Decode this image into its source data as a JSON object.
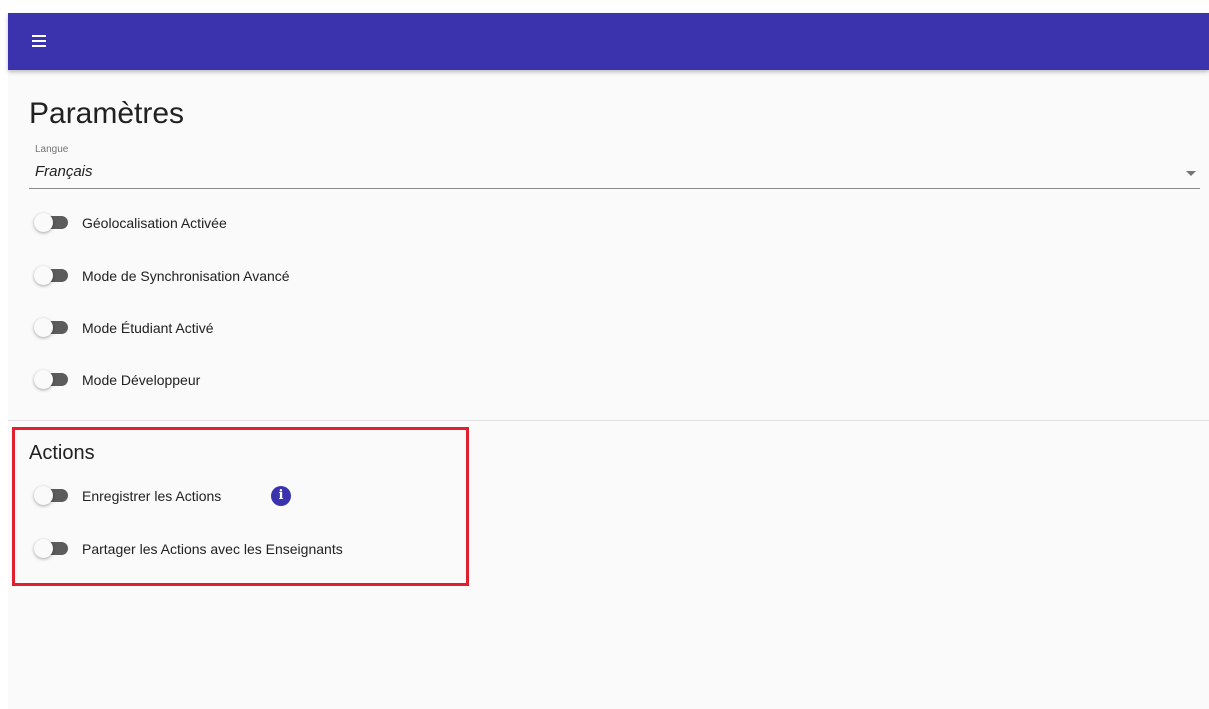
{
  "header": {
    "menu_icon": "hamburger-menu-icon",
    "background_color": "#3b33ae"
  },
  "page": {
    "title": "Paramètres"
  },
  "language": {
    "label": "Langue",
    "value": "Français",
    "caret_icon": "dropdown-arrow-icon"
  },
  "settings": {
    "geolocation": {
      "label": "Géolocalisation Activée",
      "enabled": false
    },
    "sync_mode": {
      "label": "Mode de Synchronisation Avancé",
      "enabled": false
    },
    "student_mode": {
      "label": "Mode Étudiant Activé",
      "enabled": false
    },
    "developer_mode": {
      "label": "Mode Développeur",
      "enabled": false
    }
  },
  "actions": {
    "title": "Actions",
    "record": {
      "label": "Enregistrer les Actions",
      "enabled": false,
      "info_icon": "info-icon",
      "info_glyph": "i"
    },
    "share": {
      "label": "Partager les Actions avec les Enseignants",
      "enabled": false
    }
  },
  "colors": {
    "accent": "#3b33ae",
    "highlight": "#e0202e"
  }
}
